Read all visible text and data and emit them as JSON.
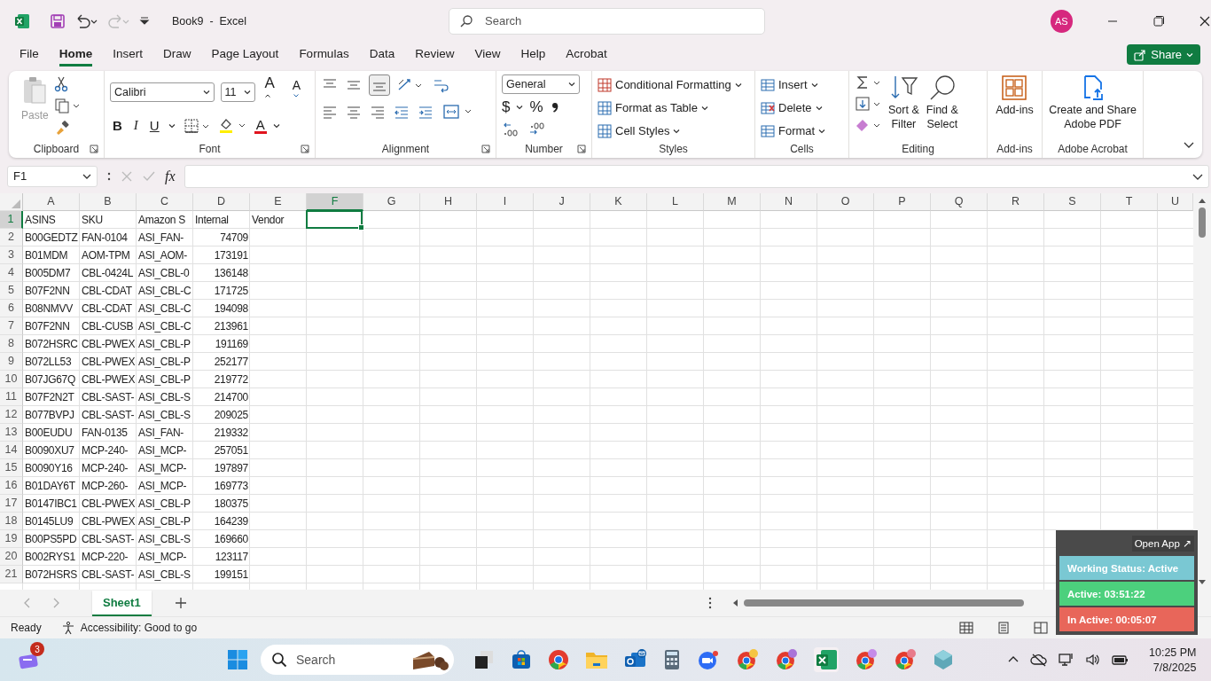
{
  "title_bar": {
    "title": "Book9  -  Excel",
    "search": {
      "placeholder": "Search"
    },
    "avatar": "AS"
  },
  "menu_tabs": [
    {
      "label": "File",
      "selected": false
    },
    {
      "label": "Home",
      "selected": true
    },
    {
      "label": "Insert",
      "selected": false
    },
    {
      "label": "Draw",
      "selected": false
    },
    {
      "label": "Page Layout",
      "selected": false
    },
    {
      "label": "Formulas",
      "selected": false
    },
    {
      "label": "Data",
      "selected": false
    },
    {
      "label": "Review",
      "selected": false
    },
    {
      "label": "View",
      "selected": false
    },
    {
      "label": "Help",
      "selected": false
    },
    {
      "label": "Acrobat",
      "selected": false
    }
  ],
  "share": "Share",
  "ribbon": {
    "clipboard": {
      "paste": "Paste",
      "paste_disabled": true,
      "label": "Clipboard"
    },
    "font": {
      "name": "Calibri",
      "size": "11",
      "grow": "A",
      "shrink": "A",
      "bold": "B",
      "italic": "I",
      "underline": "U",
      "font_color_button": "A",
      "label": "Font"
    },
    "alignment": {
      "label": "Alignment"
    },
    "number": {
      "format": "General",
      "currency": "$",
      "percent": "%",
      "label": "Number"
    },
    "styles": {
      "items": [
        "Conditional Formatting",
        "Format as Table",
        "Cell Styles"
      ],
      "label": "Styles"
    },
    "cells": {
      "items": [
        "Insert",
        "Delete",
        "Format"
      ],
      "label": "Cells"
    },
    "editing": {
      "items": [
        "Sort &\nFilter",
        "Find &\nSelect"
      ],
      "label": "Editing"
    },
    "addins": {
      "button": "Add-ins",
      "label": "Add-ins"
    },
    "acrobat": {
      "button": "Create and Share\nAdobe PDF",
      "label": "Adobe Acrobat"
    }
  },
  "formula_bar": {
    "name_box": "F1",
    "fx": "fx"
  },
  "sheet": {
    "columns": [
      {
        "label": "A",
        "selected": false
      },
      {
        "label": "B",
        "selected": false
      },
      {
        "label": "C",
        "selected": false
      },
      {
        "label": "D",
        "selected": false
      },
      {
        "label": "E",
        "selected": false
      },
      {
        "label": "F",
        "selected": true
      },
      {
        "label": "G",
        "selected": false
      },
      {
        "label": "H",
        "selected": false
      },
      {
        "label": "I",
        "selected": false
      },
      {
        "label": "J",
        "selected": false
      },
      {
        "label": "K",
        "selected": false
      },
      {
        "label": "L",
        "selected": false
      },
      {
        "label": "M",
        "selected": false
      },
      {
        "label": "N",
        "selected": false
      },
      {
        "label": "O",
        "selected": false
      },
      {
        "label": "P",
        "selected": false
      },
      {
        "label": "Q",
        "selected": false
      },
      {
        "label": "R",
        "selected": false
      },
      {
        "label": "S",
        "selected": false
      },
      {
        "label": "T",
        "selected": false
      },
      {
        "label": "U",
        "selected": false
      }
    ],
    "header_row": {
      "number": "1",
      "selected": true,
      "cells": [
        "ASINS",
        "SKU",
        "Amazon S",
        "Internal",
        "Vendor"
      ]
    },
    "rows": [
      {
        "number": "2",
        "selected": false,
        "asin": "B00GEDTZ",
        "sku": "FAN-0104",
        "amazon": "ASI_FAN-",
        "internal": "74709"
      },
      {
        "number": "3",
        "selected": false,
        "asin": "B01MDM",
        "sku": "AOM-TPM",
        "amazon": "ASI_AOM-",
        "internal": "173191"
      },
      {
        "number": "4",
        "selected": false,
        "asin": "B005DM7",
        "sku": "CBL-0424L",
        "amazon": "ASI_CBL-0",
        "internal": "136148"
      },
      {
        "number": "5",
        "selected": false,
        "asin": "B07F2NN",
        "sku": "CBL-CDAT",
        "amazon": "ASI_CBL-C",
        "internal": "171725"
      },
      {
        "number": "6",
        "selected": false,
        "asin": "B08NMVV",
        "sku": "CBL-CDAT",
        "amazon": "ASI_CBL-C",
        "internal": "194098"
      },
      {
        "number": "7",
        "selected": false,
        "asin": "B07F2NN",
        "sku": "CBL-CUSB",
        "amazon": "ASI_CBL-C",
        "internal": "213961"
      },
      {
        "number": "8",
        "selected": false,
        "asin": "B072HSRC",
        "sku": "CBL-PWEX",
        "amazon": "ASI_CBL-P",
        "internal": "191169"
      },
      {
        "number": "9",
        "selected": false,
        "asin": "B072LL53",
        "sku": "CBL-PWEX",
        "amazon": "ASI_CBL-P",
        "internal": "252177"
      },
      {
        "number": "10",
        "selected": false,
        "asin": "B07JG67Q",
        "sku": "CBL-PWEX",
        "amazon": "ASI_CBL-P",
        "internal": "219772"
      },
      {
        "number": "11",
        "selected": false,
        "asin": "B07F2N2T",
        "sku": "CBL-SAST-",
        "amazon": "ASI_CBL-S",
        "internal": "214700"
      },
      {
        "number": "12",
        "selected": false,
        "asin": "B077BVPJ",
        "sku": "CBL-SAST-",
        "amazon": "ASI_CBL-S",
        "internal": "209025"
      },
      {
        "number": "13",
        "selected": false,
        "asin": "B00EUDU",
        "sku": "FAN-0135",
        "amazon": "ASI_FAN-",
        "internal": "219332"
      },
      {
        "number": "14",
        "selected": false,
        "asin": "B0090XU7",
        "sku": "MCP-240-",
        "amazon": "ASI_MCP-",
        "internal": "257051"
      },
      {
        "number": "15",
        "selected": false,
        "asin": "B0090Y16",
        "sku": "MCP-240-",
        "amazon": "ASI_MCP-",
        "internal": "197897"
      },
      {
        "number": "16",
        "selected": false,
        "asin": "B01DAY6T",
        "sku": "MCP-260-",
        "amazon": "ASI_MCP-",
        "internal": "169773"
      },
      {
        "number": "17",
        "selected": false,
        "asin": "B0147IBC1",
        "sku": "CBL-PWEX",
        "amazon": "ASI_CBL-P",
        "internal": "180375"
      },
      {
        "number": "18",
        "selected": false,
        "asin": "B0145LU9",
        "sku": "CBL-PWEX",
        "amazon": "ASI_CBL-P",
        "internal": "164239"
      },
      {
        "number": "19",
        "selected": false,
        "asin": "B00PS5PD",
        "sku": "CBL-SAST-",
        "amazon": "ASI_CBL-S",
        "internal": "169660"
      },
      {
        "number": "20",
        "selected": false,
        "asin": "B002RYS1",
        "sku": "MCP-220-",
        "amazon": "ASI_MCP-",
        "internal": "123117"
      },
      {
        "number": "21",
        "selected": false,
        "asin": "B072HSRS",
        "sku": "CBL-SAST-",
        "amazon": "ASI_CBL-S",
        "internal": "199151"
      }
    ]
  },
  "sheet_tabs": [
    {
      "label": "Sheet1",
      "selected": true
    }
  ],
  "status_bar": {
    "ready": "Ready",
    "accessibility": "Accessibility: Good to go"
  },
  "tracker": {
    "open_app": "Open App ↗",
    "status": "Working Status: Active",
    "active": "Active: 03:51:22",
    "inactive": "In Active: 00:05:07"
  },
  "taskbar": {
    "widget_badge": "3",
    "search": {
      "placeholder": "Search"
    },
    "time": "10:25 PM",
    "date": "7/8/2025"
  }
}
